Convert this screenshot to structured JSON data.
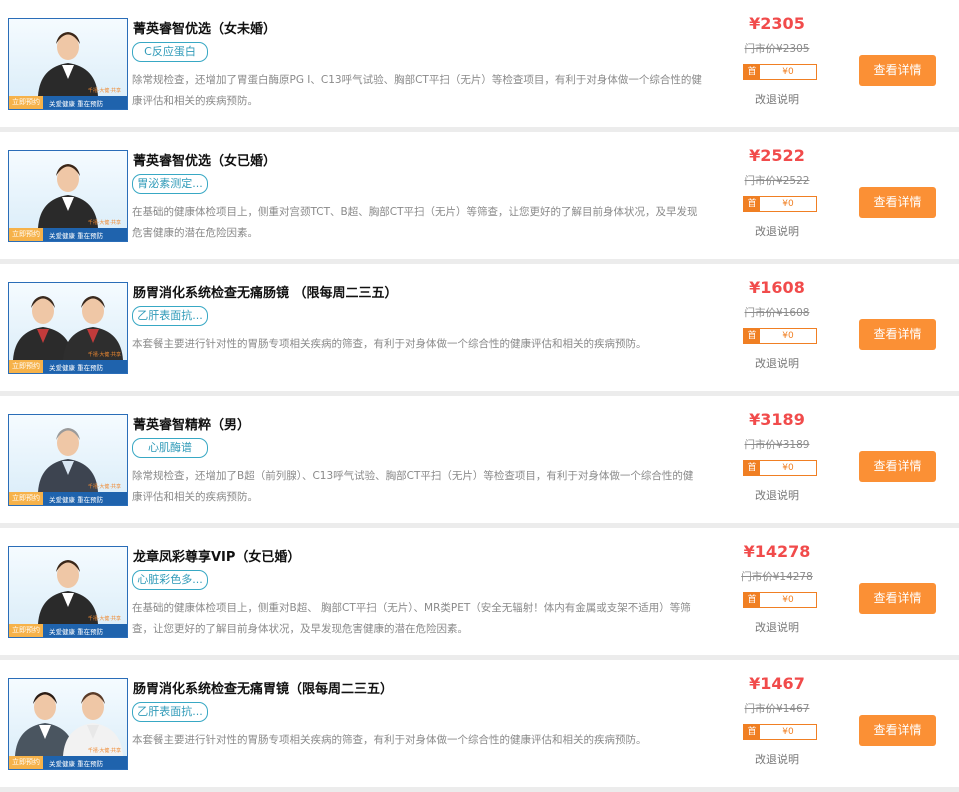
{
  "thumb": {
    "tag": "立即预约",
    "slogan": "关爱健康  重在预防",
    "tiny": "千禧·大健·共享"
  },
  "items": [
    {
      "title": "菁英睿智优选（女未婚）",
      "chip": "C反应蛋白",
      "desc": "除常规检查，还增加了胃蛋白酶原PG Ⅰ、C13呼气试验、胸部CT平扫（无片）等检查项目，有利于对身体做一个综合性的健康评估和相关的疾病预防。",
      "price": "¥2305",
      "market_price": "门市价¥2305",
      "coupon_first": "首",
      "coupon_amount": "¥0",
      "refund": "改退说明",
      "button": "查看详情",
      "person": "woman-portrait"
    },
    {
      "title": "菁英睿智优选（女已婚）",
      "chip": "胃泌素测定...",
      "desc": "在基础的健康体检项目上，侧重对宫颈TCT、B超、胸部CT平扫（无片）等筛查，让您更好的了解目前身体状况，及早发现危害健康的潜在危险因素。",
      "price": "¥2522",
      "market_price": "门市价¥2522",
      "coupon_first": "首",
      "coupon_amount": "¥0",
      "refund": "改退说明",
      "button": "查看详情",
      "person": "woman-portrait"
    },
    {
      "title": "肠胃消化系统检查无痛肠镜 （限每周二三五）",
      "chip": "乙肝表面抗...",
      "desc": "本套餐主要进行针对性的胃肠专项相关疾病的筛查，有利于对身体做一个综合性的健康评估和相关的疾病预防。",
      "price": "¥1608",
      "market_price": "门市价¥1608",
      "coupon_first": "首",
      "coupon_amount": "¥0",
      "refund": "改退说明",
      "button": "查看详情",
      "person": "two-men-portrait"
    },
    {
      "title": "菁英睿智精粹（男）",
      "chip": "心肌酶谱",
      "desc": "除常规检查，还增加了B超（前列腺）、C13呼气试验、胸部CT平扫（无片）等检查项目，有利于对身体做一个综合性的健康评估和相关的疾病预防。",
      "price": "¥3189",
      "market_price": "门市价¥3189",
      "coupon_first": "首",
      "coupon_amount": "¥0",
      "refund": "改退说明",
      "button": "查看详情",
      "person": "man-portrait"
    },
    {
      "title": "龙章凤彩尊享VIP（女已婚）",
      "chip": "心脏彩色多...",
      "desc": "在基础的健康体检项目上，侧重对B超、 胸部CT平扫（无片）、MR类PET（安全无辐射！体内有金属或支架不适用）等筛查，让您更好的了解目前身体状况，及早发现危害健康的潜在危险因素。",
      "price": "¥14278",
      "market_price": "门市价¥14278",
      "coupon_first": "首",
      "coupon_amount": "¥0",
      "refund": "改退说明",
      "button": "查看详情",
      "person": "woman-portrait"
    },
    {
      "title": "肠胃消化系统检查无痛胃镜（限每周二三五）",
      "chip": "乙肝表面抗...",
      "desc": "本套餐主要进行针对性的胃肠专项相关疾病的筛查，有利于对身体做一个综合性的健康评估和相关的疾病预防。",
      "price": "¥1467",
      "market_price": "门市价¥1467",
      "coupon_first": "首",
      "coupon_amount": "¥0",
      "refund": "改退说明",
      "button": "查看详情",
      "person": "couple-portrait"
    }
  ],
  "colors": {
    "price": "#f14b4b",
    "button": "#fb9035",
    "chip": "#38a8c4",
    "coupon": "#f07f23",
    "banner": "#1f63ad"
  }
}
